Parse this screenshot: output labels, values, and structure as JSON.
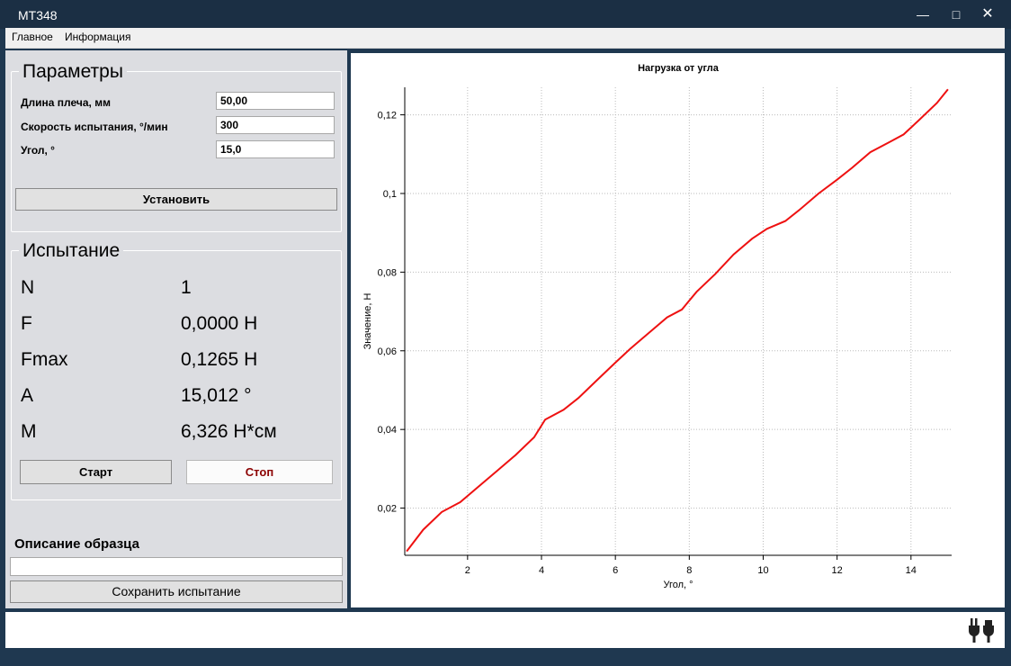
{
  "window": {
    "title": "MT348"
  },
  "menu": {
    "items": [
      "Главное",
      "Информация"
    ]
  },
  "params": {
    "title": "Параметры",
    "arm_length_label": "Длина плеча, мм",
    "arm_length_value": "50,00",
    "speed_label": "Скорость испытания, °/мин",
    "speed_value": "300",
    "angle_label": "Угол, °",
    "angle_value": "15,0",
    "set_button": "Установить"
  },
  "test": {
    "title": "Испытание",
    "rows": [
      {
        "label": "N",
        "value": "1"
      },
      {
        "label": "F",
        "value": "0,0000 Н"
      },
      {
        "label": "Fmax",
        "value": "0,1265 Н"
      },
      {
        "label": "A",
        "value": "15,012 °"
      },
      {
        "label": "M",
        "value": "6,326 Н*см"
      }
    ],
    "start_button": "Старт",
    "stop_button": "Стоп",
    "stop_color": "#8b0000"
  },
  "sample": {
    "label": "Описание образца",
    "description": "",
    "save_button": "Сохранить испытание"
  },
  "status": {
    "icon": "plug-icon"
  },
  "chart_data": {
    "type": "line",
    "title": "Нагрузка от угла",
    "xlabel": "Угол, °",
    "ylabel": "Значение, Н",
    "xlim": [
      0.3,
      15.1
    ],
    "ylim": [
      0.008,
      0.127
    ],
    "xticks": [
      2,
      4,
      6,
      8,
      10,
      12,
      14
    ],
    "yticks": [
      0.02,
      0.04,
      0.06,
      0.08,
      0.1,
      0.12
    ],
    "xtick_labels": [
      "2",
      "4",
      "6",
      "8",
      "10",
      "12",
      "14"
    ],
    "ytick_labels": [
      "0,02",
      "0,04",
      "0,06",
      "0,08",
      "0,1",
      "0,12"
    ],
    "grid": true,
    "series": [
      {
        "color": "#ee1111",
        "x": [
          0.35,
          0.8,
          1.3,
          1.8,
          2.3,
          2.8,
          3.3,
          3.8,
          4.1,
          4.6,
          5.0,
          5.5,
          6.0,
          6.4,
          6.9,
          7.4,
          7.8,
          8.2,
          8.7,
          9.2,
          9.7,
          10.1,
          10.6,
          11.0,
          11.5,
          12.0,
          12.4,
          12.9,
          13.4,
          13.8,
          14.2,
          14.7,
          15.0
        ],
        "y": [
          0.009,
          0.0145,
          0.019,
          0.0215,
          0.0255,
          0.0295,
          0.0335,
          0.038,
          0.0425,
          0.045,
          0.048,
          0.0525,
          0.057,
          0.0605,
          0.0645,
          0.0685,
          0.0705,
          0.075,
          0.0795,
          0.0845,
          0.0885,
          0.091,
          0.093,
          0.096,
          0.1,
          0.1035,
          0.1065,
          0.1105,
          0.113,
          0.115,
          0.1185,
          0.123,
          0.1265
        ]
      }
    ]
  }
}
